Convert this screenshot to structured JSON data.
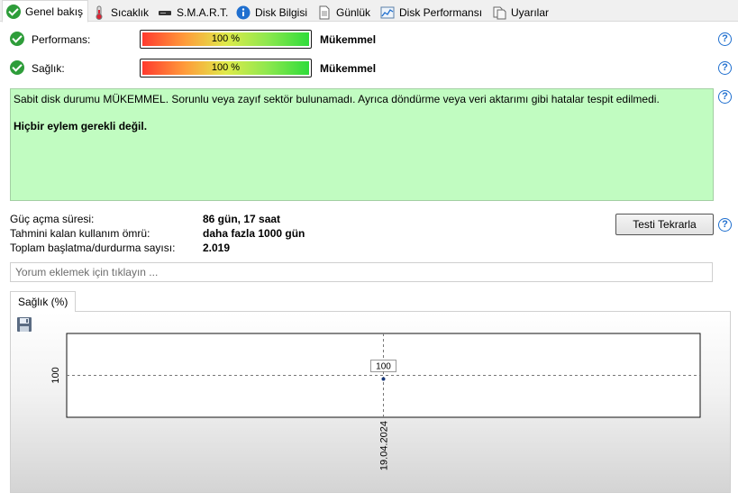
{
  "tabs": [
    {
      "label": "Genel bakış",
      "icon": "check-circle-icon",
      "active": true
    },
    {
      "label": "Sıcaklık",
      "icon": "thermometer-icon",
      "active": false
    },
    {
      "label": "S.M.A.R.T.",
      "icon": "drive-icon",
      "active": false
    },
    {
      "label": "Disk Bilgisi",
      "icon": "info-icon",
      "active": false
    },
    {
      "label": "Günlük",
      "icon": "document-icon",
      "active": false
    },
    {
      "label": "Disk Performansı",
      "icon": "performance-chart-icon",
      "active": false
    },
    {
      "label": "Uyarılar",
      "icon": "alerts-icon",
      "active": false
    }
  ],
  "performance": {
    "label": "Performans:",
    "percent_text": "100 %",
    "level": 1.0,
    "rating": "Mükemmel"
  },
  "health": {
    "label": "Sağlık:",
    "percent_text": "100 %",
    "level": 1.0,
    "rating": "Mükemmel"
  },
  "status": {
    "message": "Sabit disk durumu MÜKEMMEL. Sorunlu veya zayıf sektör bulunamadı. Ayrıca döndürme veya veri aktarımı gibi hatalar tespit edilmedi.",
    "action": "Hiçbir eylem gerekli değil.",
    "background": "#c1fcc1"
  },
  "info": {
    "power_on_label": "Güç açma süresi:",
    "power_on_value": "86 gün, 17 saat",
    "lifetime_label": "Tahmini kalan kullanım ömrü:",
    "lifetime_value": "daha fazla 1000 gün",
    "startstop_label": "Toplam başlatma/durdurma sayısı:",
    "startstop_value": "2.019"
  },
  "retest_button": "Testi Tekrarla",
  "help_icon": "?",
  "comment": {
    "placeholder": "Yorum eklemek için tıklayın ..."
  },
  "chart_tab": "Sağlık (%)",
  "chart_data": {
    "type": "line",
    "series": [
      {
        "x": [
          "19.04.2024"
        ],
        "values": [
          100
        ]
      }
    ],
    "y_tick_labels": [
      "100"
    ],
    "x_tick_labels": [
      "19.04.2024"
    ],
    "data_labels": [
      "100"
    ],
    "ylim": [
      100,
      100
    ],
    "grid": true
  }
}
